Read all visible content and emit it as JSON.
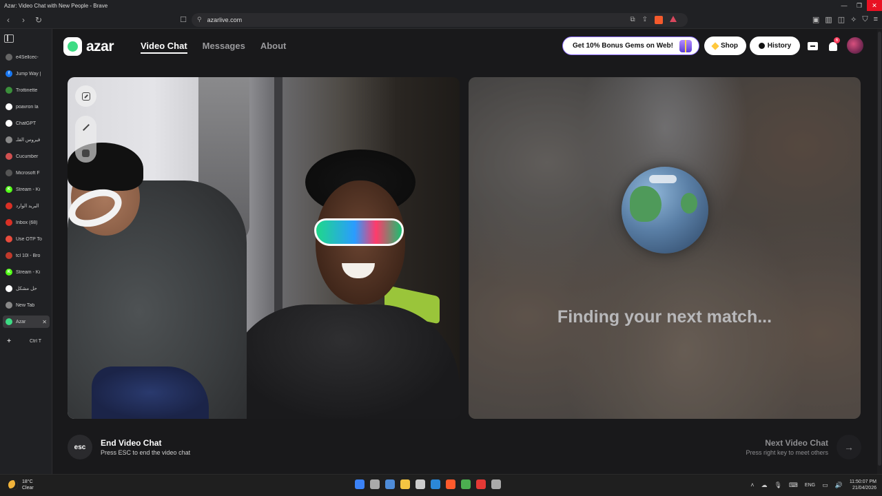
{
  "window": {
    "title": "Azar: Video Chat with New People - Brave",
    "minimize_glyph": "—",
    "restore_glyph": "❐",
    "close_glyph": "✕",
    "close_tooltip": "Close"
  },
  "browser": {
    "url": "azarlive.com",
    "back_glyph": "‹",
    "forward_glyph": "›",
    "reload_glyph": "↻"
  },
  "tabs": [
    {
      "label": "e4Sellcec-",
      "color": "#666666",
      "glyph": ""
    },
    {
      "label": "Jump Way |",
      "color": "#1877f2",
      "glyph": "f"
    },
    {
      "label": "Trottinette",
      "color": "#3b8f3b",
      "glyph": ""
    },
    {
      "label": "poavron la",
      "color": "#ffffff",
      "glyph": ""
    },
    {
      "label": "ChatGPT",
      "color": "#ffffff",
      "glyph": ""
    },
    {
      "label": "فيروس القلـ",
      "color": "#888888",
      "glyph": ""
    },
    {
      "label": "Cucumber",
      "color": "#d05050",
      "glyph": ""
    },
    {
      "label": "Microsoft F",
      "color": "#555555",
      "glyph": ""
    },
    {
      "label": "Stream - Ki",
      "color": "#53fc18",
      "glyph": "K"
    },
    {
      "label": "البريد الوارد",
      "color": "#d93025",
      "glyph": ""
    },
    {
      "label": "Inbox (68)",
      "color": "#d93025",
      "glyph": ""
    },
    {
      "label": "Use OTP To",
      "color": "#e84c3d",
      "glyph": ""
    },
    {
      "label": "tcl 10l - Bro",
      "color": "#c0392b",
      "glyph": ""
    },
    {
      "label": "Stream - Ki",
      "color": "#53fc18",
      "glyph": "K"
    },
    {
      "label": "حل مشكل",
      "color": "#ffffff",
      "glyph": ""
    },
    {
      "label": "New Tab",
      "color": "#888888",
      "glyph": ""
    },
    {
      "label": "Azar",
      "color": "#3ddc84",
      "glyph": ""
    }
  ],
  "new_tab": {
    "plus": "+",
    "shortcut": "Ctrl T"
  },
  "azar": {
    "logo_text": "azar",
    "nav": [
      "Video Chat",
      "Messages",
      "About"
    ],
    "promo": "Get 10% Bonus Gems on Web!",
    "shop": "Shop",
    "history": "History",
    "notification_count": "6",
    "finding_text": "Finding your next match...",
    "end": {
      "key": "esc",
      "title": "End Video Chat",
      "subtitle": "Press ESC to end the video chat"
    },
    "next": {
      "title": "Next Video Chat",
      "subtitle": "Press right key to meet others",
      "arrow": "→"
    }
  },
  "taskbar": {
    "temp": "18°C",
    "weather": "Clear",
    "lang": "ENG",
    "time": "11:50:07 PM",
    "date": "21/04/2026",
    "apps_colors": [
      "#3b82f6",
      "#aaaaaa",
      "#4e8cd9",
      "#f4c542",
      "#cccccc",
      "#2b88d8",
      "#ff5a2c",
      "#4caf50",
      "#e53935",
      "#aaaaaa"
    ]
  }
}
